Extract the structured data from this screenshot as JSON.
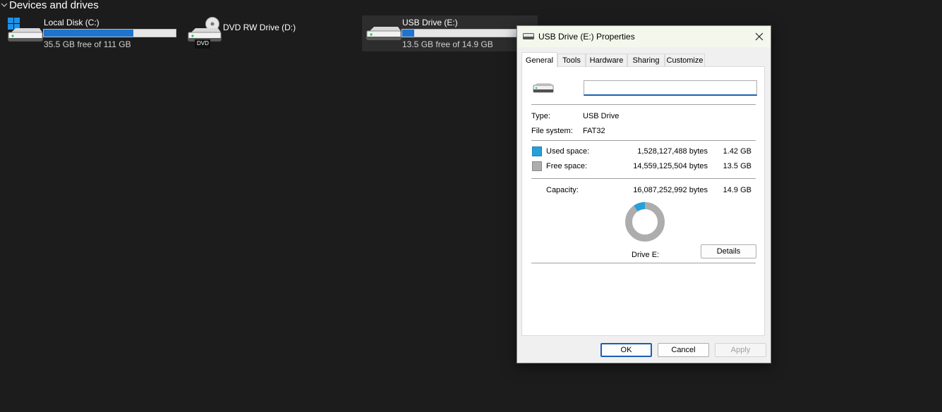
{
  "explorer": {
    "section_title": "Devices and drives",
    "drives": [
      {
        "name": "Local Disk (C:)",
        "free_text": "35.5 GB free of 111 GB",
        "used_fraction": 0.68
      },
      {
        "name": "DVD RW Drive (D:)",
        "badge": "DVD"
      },
      {
        "name": "USB Drive (E:)",
        "free_text": "13.5 GB free of 14.9 GB",
        "used_fraction": 0.095
      }
    ]
  },
  "dialog": {
    "title": "USB Drive (E:) Properties",
    "tabs": [
      "General",
      "Tools",
      "Hardware",
      "Sharing",
      "Customize"
    ],
    "active_tab": "General",
    "volume_label_value": "",
    "type_label": "Type:",
    "type_value": "USB Drive",
    "fs_label": "File system:",
    "fs_value": "FAT32",
    "used_label": "Used space:",
    "used_bytes": "1,528,127,488 bytes",
    "used_gb": "1.42 GB",
    "free_label": "Free space:",
    "free_bytes": "14,559,125,504 bytes",
    "free_gb": "13.5 GB",
    "capacity_label": "Capacity:",
    "capacity_bytes": "16,087,252,992 bytes",
    "capacity_gb": "14.9 GB",
    "drive_label": "Drive E:",
    "details_button": "Details",
    "ok_button": "OK",
    "cancel_button": "Cancel",
    "apply_button": "Apply",
    "used_fraction": 0.095,
    "colors": {
      "used": "#26a0da",
      "free": "#adadad"
    }
  }
}
